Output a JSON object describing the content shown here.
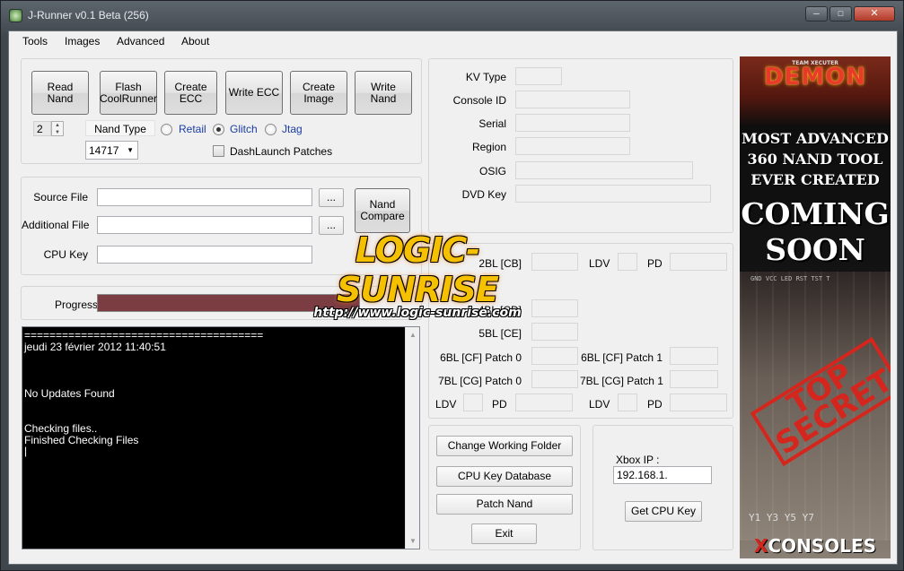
{
  "window": {
    "title": "J-Runner v0.1 Beta (256)",
    "min_glyph": "▫",
    "max_glyph": "▫",
    "close_glyph": "x"
  },
  "menu": [
    "Tools",
    "Images",
    "Advanced",
    "About"
  ],
  "actions": {
    "read_nand": "Read\nNand",
    "flash_coolrunner": "Flash\nCoolRunner",
    "create_ecc": "Create\nECC",
    "write_ecc": "Write ECC",
    "create_image": "Create\nImage",
    "write_nand": "Write\nNand"
  },
  "nand": {
    "count": "2",
    "type_label": "Nand Type",
    "type_value": "14717",
    "options": [
      "Retail",
      "Glitch",
      "Jtag"
    ],
    "selected": "Glitch",
    "dashlaunch_label": "DashLaunch Patches"
  },
  "files": {
    "source_label": "Source File",
    "additional_label": "Additional File",
    "cpu_key_label": "CPU Key",
    "browse": "...",
    "compare_label": "Nand\nCompare"
  },
  "progress": {
    "label": "Progress",
    "value": 1.0
  },
  "console": {
    "lines": [
      "======================================",
      "jeudi 23 février 2012 11:40:51",
      "",
      "",
      "No Updates Found",
      "",
      "Checking files..",
      "Finished Checking Files",
      "|"
    ]
  },
  "info": {
    "kv_type": "KV Type",
    "console_id": "Console ID",
    "serial": "Serial",
    "region": "Region",
    "osig": "OSIG",
    "dvd_key": "DVD Key"
  },
  "bootloaders": {
    "row1_label": "2BL [CB]",
    "ldv": "LDV",
    "pd": "PD",
    "bl4": "4BL [CD]",
    "bl5": "5BL [CE]",
    "bl6_p0": "6BL [CF] Patch 0",
    "bl6_p1": "6BL [CF] Patch 1",
    "bl7_p0": "7BL [CG] Patch 0",
    "bl7_p1": "7BL [CG] Patch 1"
  },
  "tools": {
    "change_folder": "Change Working Folder",
    "cpu_db": "CPU Key Database",
    "patch_nand": "Patch Nand",
    "exit": "Exit"
  },
  "xbox": {
    "ip_label": "Xbox IP :",
    "ip_value": "192.168.1.",
    "get_key": "Get CPU Key"
  },
  "ad": {
    "team": "TEAM XECUTER",
    "brand": "DEMON",
    "line1": "MOST ADVANCED\n360 NAND TOOL\nEVER CREATED",
    "line2": "COMING\nSOON",
    "pins": "GND VCC LED RST TST T",
    "stamp": "TOP\nSECRET",
    "pins2": "Y1  Y3  Y5  Y7",
    "footer_x": "X",
    "footer": "CONSOLES"
  },
  "watermark": {
    "main": "LOGIC-SUNRISE",
    "url": "http://www.logic-sunrise.com"
  },
  "colors": {
    "progress": "#7b3c42",
    "accent_red": "#d4261d",
    "watermark": "#f5c000"
  }
}
